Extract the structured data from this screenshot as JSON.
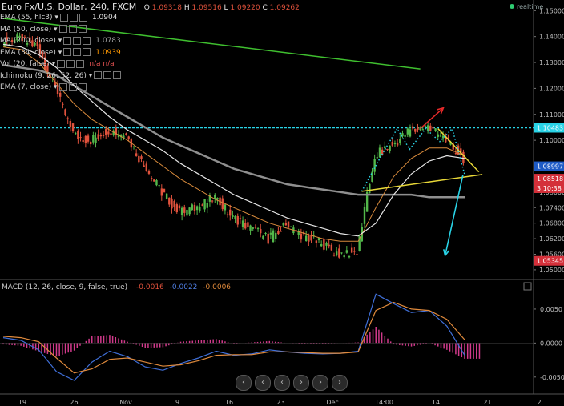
{
  "header": {
    "title": "Euro Fx/U.S. Dollar, 240, FXCM",
    "ohlc": [
      {
        "k": "O",
        "v": "1.09318"
      },
      {
        "k": "H",
        "v": "1.09516"
      },
      {
        "k": "L",
        "v": "1.09220"
      },
      {
        "k": "C",
        "v": "1.09262"
      }
    ],
    "realtime": "realtime"
  },
  "indicators": [
    {
      "label": "EMA (55, hlc3)",
      "value": "1.0904",
      "color": "#ffffff"
    },
    {
      "label": "MA (50, close)",
      "value": "",
      "color": "#ffffff"
    },
    {
      "label": "MA (200, close)",
      "value": "1.0783",
      "color": "#9e9e9e"
    },
    {
      "label": "EMA (34, close)",
      "value": "1.0939",
      "color": "#ff9800"
    },
    {
      "label": "Vol (20, false)",
      "value": "n/a n/a",
      "color": "#e05050"
    },
    {
      "label": "Ichimoku (9, 26, 52, 26)",
      "value": "",
      "color": "#ffffff"
    },
    {
      "label": "EMA (7, close)",
      "value": "",
      "color": "#ffffff"
    }
  ],
  "colors": {
    "up": "#53b84a",
    "down": "#e0523c",
    "green_line": "#3fbf2f",
    "yellow_line": "#e8d838",
    "cyan": "#29d3e6",
    "red_arrow": "#e52a2a",
    "ema34": "#d98b3c",
    "ma200": "#8f8f8f",
    "ema55": "#e6e6e6"
  },
  "chart_data": [
    {
      "type": "line",
      "title": "Euro Fx/U.S. Dollar, 240, FXCM",
      "x_ticks": [
        "19",
        "26",
        "Nov",
        "9",
        "16",
        "23",
        "Dec",
        "14:00",
        "14",
        "21",
        "2"
      ],
      "y_ticks": [
        "1.15000",
        "1.14000",
        "1.13000",
        "1.12000",
        "1.11000",
        "1.10000",
        "1.09000",
        "1.08000",
        "1.07400",
        "1.06800",
        "1.06200",
        "1.05600",
        "1.05000"
      ],
      "ylim": [
        1.0475,
        1.1535
      ],
      "price_labels": [
        {
          "value": 1.10483,
          "text": "1.10483",
          "color": "#29d3e6"
        },
        {
          "value": 1.08997,
          "text": "1.08997",
          "color": "#1e5bc6"
        },
        {
          "value": 1.08518,
          "text": "1.08518",
          "color": "#d4303a"
        },
        {
          "value": 1.0815,
          "text": "3:10:38",
          "color": "#d4303a"
        },
        {
          "value": 1.05345,
          "text": "1.05345",
          "color": "#d4303a"
        }
      ],
      "series": [
        {
          "name": "EMA (55, hlc3)",
          "values": [
            1.137,
            1.136,
            1.133,
            1.128,
            1.121,
            1.115,
            1.109,
            1.104,
            1.1,
            1.096,
            1.091,
            1.087,
            1.083,
            1.079,
            1.076,
            1.073,
            1.07,
            1.068,
            1.066,
            1.064,
            1.063,
            1.068,
            1.079,
            1.087,
            1.092,
            1.094,
            1.093
          ]
        },
        {
          "name": "MA (200, close)",
          "values": [
            1.129,
            1.128,
            1.127,
            1.125,
            1.121,
            1.117,
            1.113,
            1.109,
            1.105,
            1.101,
            1.098,
            1.095,
            1.092,
            1.089,
            1.087,
            1.085,
            1.083,
            1.082,
            1.081,
            1.08,
            1.079,
            1.079,
            1.079,
            1.079,
            1.078,
            1.078,
            1.078
          ]
        },
        {
          "name": "EMA (34, close)",
          "values": [
            1.136,
            1.135,
            1.13,
            1.122,
            1.114,
            1.108,
            1.104,
            1.1,
            1.095,
            1.09,
            1.085,
            1.081,
            1.077,
            1.074,
            1.071,
            1.068,
            1.066,
            1.064,
            1.062,
            1.061,
            1.061,
            1.074,
            1.086,
            1.093,
            1.097,
            1.097,
            1.094
          ]
        },
        {
          "name": "Close",
          "values": [
            1.138,
            1.139,
            1.136,
            1.12,
            1.102,
            1.1,
            1.104,
            1.102,
            1.09,
            1.08,
            1.072,
            1.074,
            1.078,
            1.07,
            1.066,
            1.062,
            1.067,
            1.063,
            1.06,
            1.056,
            1.057,
            1.094,
            1.098,
            1.104,
            1.105,
            1.1,
            1.093
          ]
        }
      ],
      "trendlines": [
        {
          "name": "Green resistance",
          "from": [
            0,
            1.147
          ],
          "to": [
            23.5,
            1.1275
          ]
        },
        {
          "name": "Yellow support",
          "from": [
            20.2,
            1.0803
          ],
          "to": [
            27.0,
            1.0868
          ]
        },
        {
          "name": "Yellow resistance",
          "from": [
            24.5,
            1.1045
          ],
          "to": [
            26.8,
            1.0878
          ]
        }
      ]
    },
    {
      "type": "line",
      "title": "MACD (12, 26, close, 9, false, true)",
      "values_text": [
        "-0.0016",
        "-0.0022",
        "-0.0006"
      ],
      "y_ticks": [
        "0.0050",
        "0.0000",
        "-0.0050"
      ],
      "ylim": [
        -0.0075,
        0.009
      ],
      "series": [
        {
          "name": "MACD",
          "values": [
            0.0008,
            0.0004,
            -0.001,
            -0.0042,
            -0.0055,
            -0.0028,
            -0.0012,
            -0.002,
            -0.0035,
            -0.004,
            -0.003,
            -0.0022,
            -0.0012,
            -0.0018,
            -0.0016,
            -0.001,
            -0.0013,
            -0.0015,
            -0.0016,
            -0.0015,
            -0.0012,
            0.0072,
            0.0058,
            0.0045,
            0.0048,
            0.0025,
            -0.0018
          ]
        },
        {
          "name": "Signal",
          "values": [
            0.001,
            0.0008,
            0.0002,
            -0.0022,
            -0.0044,
            -0.0038,
            -0.0024,
            -0.0022,
            -0.0028,
            -0.0034,
            -0.0032,
            -0.0026,
            -0.0018,
            -0.0017,
            -0.0017,
            -0.0013,
            -0.0013,
            -0.0014,
            -0.0015,
            -0.0015,
            -0.0013,
            0.0048,
            0.006,
            0.005,
            0.0048,
            0.0035,
            0.0005
          ]
        },
        {
          "name": "Histogram",
          "values": [
            -0.0002,
            -0.0004,
            -0.0012,
            -0.002,
            -0.0011,
            0.001,
            0.0012,
            0.0002,
            -0.0007,
            -0.0006,
            0.0002,
            0.0004,
            0.0006,
            -0.0001,
            0.0001,
            0.0003,
            0.0,
            -0.0001,
            -0.0001,
            0.0,
            0.0001,
            0.0024,
            -0.0002,
            -0.0005,
            0.0,
            -0.001,
            -0.0023
          ]
        }
      ]
    }
  ],
  "nav": [
    "‹",
    "‹",
    "‹",
    "›",
    "›",
    "›"
  ]
}
